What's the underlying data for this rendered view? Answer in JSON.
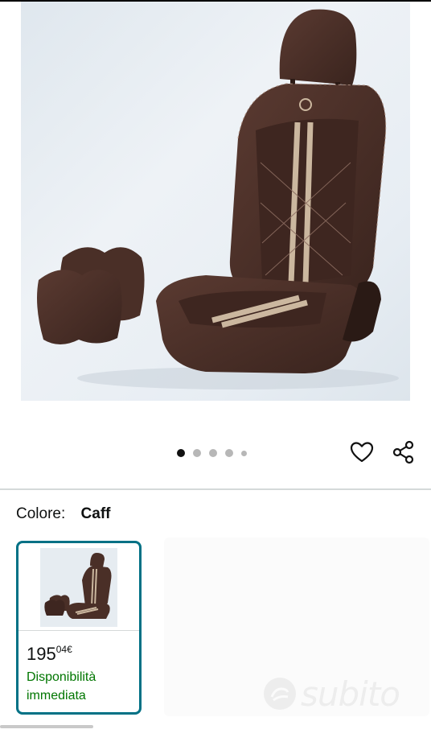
{
  "gallery": {
    "image_count": 5,
    "active_index": 0,
    "image_alt": "",
    "actions": {
      "favorite_icon": "heart-icon",
      "share_icon": "share-icon"
    }
  },
  "variation": {
    "label": "Colore:",
    "selected_value": "Caff",
    "options": [
      {
        "price_whole": "195",
        "price_fraction": "04",
        "currency": "€",
        "availability": "Disponibilità immediata",
        "selected": true
      }
    ]
  },
  "watermark": {
    "text": "subito"
  },
  "colors": {
    "seat_brown": "#4a2f27",
    "stripe_beige": "#cbb79f",
    "accent_teal": "#007185",
    "availability_green": "#007600"
  }
}
